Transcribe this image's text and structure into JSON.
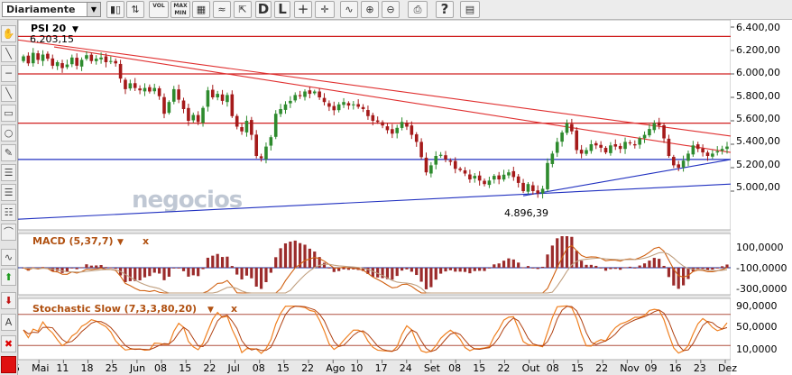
{
  "toolbar": {
    "period_select": "Diariamente",
    "vol_label": "VOL",
    "maxmin_label": "MAX MIN",
    "daily_label": "D",
    "line_label": "L",
    "plus_label": "+",
    "help_label": "?"
  },
  "colors": {
    "up": "#2e8b2e",
    "down": "#a51a1a",
    "trend_red": "#e03030",
    "level_red": "#d02020",
    "trend_blue": "#2030c0",
    "macd_line": "#d06010",
    "signal_line": "#c0a080",
    "stoch_k": "#f08020",
    "stoch_d": "#b04010",
    "hist": "#9b2b2b",
    "watermark": "#c0c8d4"
  },
  "watermark": "negocios",
  "main_panel": {
    "symbol": "PSI 20",
    "max_label": "6.203,15",
    "min_label": "4.896,39",
    "y_ticks": [
      "6.400,00",
      "6.200,00",
      "6.000,00",
      "5.800,00",
      "5.600,00",
      "5.400,00",
      "5.200,00",
      "5.000,00"
    ]
  },
  "macd_panel": {
    "title": "MACD (5,37,7)",
    "close_label": "x",
    "y_ticks": [
      "100,0000",
      "-100,0000",
      "-300,0000"
    ]
  },
  "stoch_panel": {
    "title": "Stochastic Slow (7,3,3,80,20)",
    "close_label": "x",
    "y_ticks": [
      "90,0000",
      "50,0000",
      "10,0000"
    ]
  },
  "x_axis": {
    "labels": [
      "15",
      "Mai",
      "11",
      "18",
      "25",
      "Jun",
      "08",
      "15",
      "22",
      "Jul",
      "08",
      "15",
      "22",
      "Ago",
      "10",
      "17",
      "24",
      "Set",
      "08",
      "15",
      "22",
      "Out",
      "08",
      "15",
      "22",
      "Nov",
      "09",
      "16",
      "23",
      "Dez"
    ]
  },
  "chart_data": {
    "type": "candlestick",
    "price_range": [
      4800,
      6450
    ],
    "horizontal_levels": [
      6320,
      6000,
      5580,
      5270
    ],
    "closes": [
      6150,
      6090,
      6180,
      6120,
      6165,
      6130,
      6070,
      6100,
      6050,
      6080,
      6140,
      6070,
      6120,
      6160,
      6110,
      6130,
      6140,
      6100,
      6110,
      6090,
      5960,
      5870,
      5920,
      5880,
      5860,
      5880,
      5850,
      5880,
      5810,
      5660,
      5760,
      5870,
      5780,
      5700,
      5600,
      5650,
      5590,
      5710,
      5860,
      5800,
      5830,
      5770,
      5820,
      5640,
      5550,
      5510,
      5600,
      5480,
      5300,
      5280,
      5380,
      5460,
      5660,
      5700,
      5740,
      5770,
      5820,
      5810,
      5850,
      5830,
      5850,
      5800,
      5760,
      5720,
      5690,
      5740,
      5760,
      5730,
      5740,
      5720,
      5700,
      5640,
      5600,
      5590,
      5560,
      5520,
      5490,
      5540,
      5590,
      5550,
      5480,
      5420,
      5290,
      5160,
      5220,
      5300,
      5310,
      5270,
      5250,
      5190,
      5180,
      5150,
      5100,
      5130,
      5090,
      5060,
      5090,
      5130,
      5100,
      5140,
      5160,
      5120,
      5070,
      5000,
      5060,
      5000,
      4980,
      5020,
      5240,
      5320,
      5420,
      5500,
      5580,
      5510,
      5350,
      5320,
      5350,
      5400,
      5390,
      5370,
      5330,
      5390,
      5380,
      5360,
      5420,
      5410,
      5390,
      5450,
      5480,
      5530,
      5580,
      5560,
      5450,
      5300,
      5220,
      5200,
      5260,
      5320,
      5390,
      5360,
      5330,
      5300,
      5320,
      5340,
      5360,
      5380
    ]
  }
}
